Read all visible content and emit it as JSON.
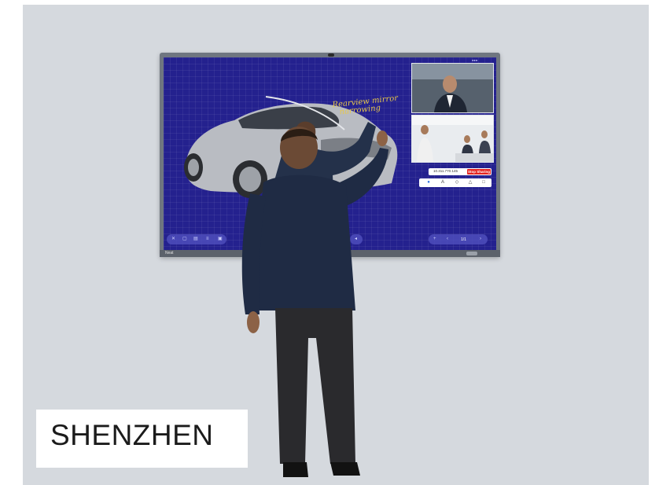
{
  "location_label": "SHENZHEN",
  "board": {
    "brand": "Neat",
    "handwriting_line1": "Rearview mirror",
    "handwriting_line2": "narrowing",
    "share_address": "10.311.770.145",
    "stop_sharing_label": "Stop Sharing",
    "page_indicator": "1/1",
    "tools": [
      "pen-dot-icon",
      "text-icon",
      "eraser-icon",
      "shape-icon",
      "save-icon"
    ],
    "left_controls": [
      "close-icon",
      "new-page-icon",
      "folder-icon",
      "menu-icon",
      "save-icon"
    ],
    "right_controls": [
      "add-page-icon",
      "prev-page-icon",
      "next-page-icon"
    ],
    "colors": {
      "screen": "#24218e",
      "stop_button": "#e42420",
      "ink": "#e8c84a"
    }
  }
}
